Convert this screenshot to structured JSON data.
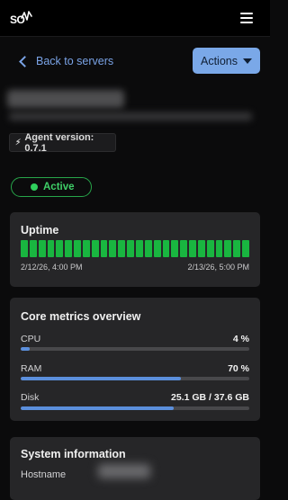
{
  "header": {
    "logo_text": "SO",
    "menu_icon": "hamburger-menu-icon"
  },
  "nav": {
    "back_label": "Back to servers",
    "actions_label": "Actions"
  },
  "server": {
    "agent_version": "Agent version: 0.7.1",
    "status": "Active"
  },
  "uptime": {
    "title": "Uptime",
    "bar_count": 26,
    "start_time": "2/12/26, 4:00 PM",
    "end_time": "2/13/26, 5:00 PM",
    "bar_color": "#19b640"
  },
  "metrics": {
    "title": "Core metrics overview",
    "items": [
      {
        "label": "CPU",
        "value": "4 %",
        "fraction": 0.04
      },
      {
        "label": "RAM",
        "value": "70 %",
        "fraction": 0.7
      },
      {
        "label": "Disk",
        "value": "25.1 GB / 37.6 GB",
        "fraction": 0.668
      }
    ],
    "fill_color": "#5b8fdc"
  },
  "system_info": {
    "title": "System information",
    "hostname_label": "Hostname"
  },
  "colors": {
    "accent": "#7aa8e8",
    "active": "#2fcf5c"
  }
}
